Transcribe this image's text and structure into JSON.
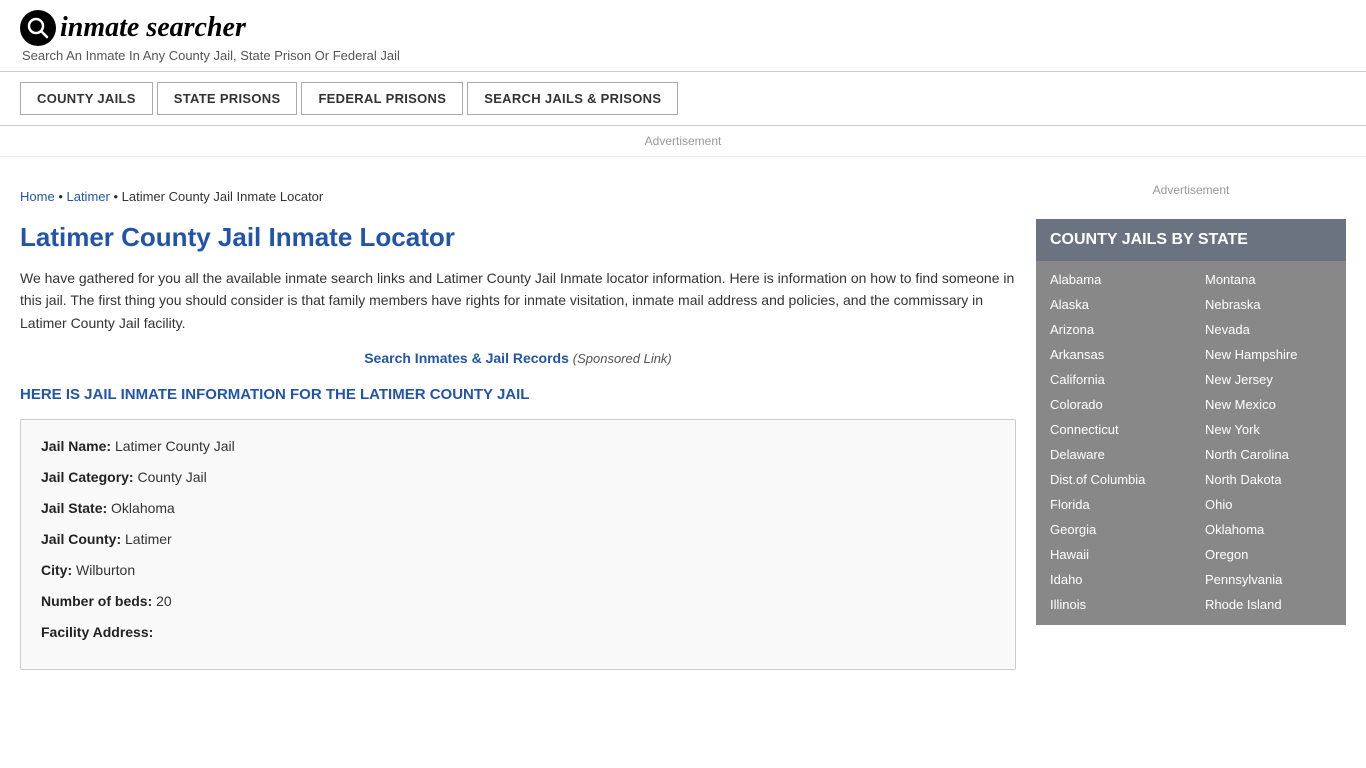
{
  "logo": {
    "icon_text": "Q",
    "text": "inmate searcher",
    "tagline": "Search An Inmate In Any County Jail, State Prison Or Federal Jail"
  },
  "nav": {
    "items": [
      {
        "label": "COUNTY JAILS"
      },
      {
        "label": "STATE PRISONS"
      },
      {
        "label": "FEDERAL PRISONS"
      },
      {
        "label": "SEARCH JAILS & PRISONS"
      }
    ]
  },
  "ad_top": "Advertisement",
  "breadcrumb": {
    "home": "Home",
    "parent": "Latimer",
    "current": "Latimer County Jail Inmate Locator"
  },
  "page_title": "Latimer County Jail Inmate Locator",
  "description": "We have gathered for you all the available inmate search links and Latimer County Jail Inmate locator information. Here is information on how to find someone in this jail. The first thing you should consider is that family members have rights for inmate visitation, inmate mail address and policies, and the commissary in Latimer County Jail facility.",
  "search_link": {
    "label": "Search Inmates & Jail Records",
    "sponsored": "(Sponsored Link)"
  },
  "jail_info_header": "HERE IS JAIL INMATE INFORMATION FOR THE LATIMER COUNTY JAIL",
  "jail_info": {
    "name_label": "Jail Name:",
    "name_value": "Latimer County Jail",
    "category_label": "Jail Category:",
    "category_value": "County Jail",
    "state_label": "Jail State:",
    "state_value": "Oklahoma",
    "county_label": "Jail County:",
    "county_value": "Latimer",
    "city_label": "City:",
    "city_value": "Wilburton",
    "beds_label": "Number of beds:",
    "beds_value": "20",
    "address_label": "Facility Address:"
  },
  "sidebar": {
    "ad": "Advertisement",
    "box_title": "COUNTY JAILS BY STATE",
    "states_left": [
      "Alabama",
      "Alaska",
      "Arizona",
      "Arkansas",
      "California",
      "Colorado",
      "Connecticut",
      "Delaware",
      "Dist.of Columbia",
      "Florida",
      "Georgia",
      "Hawaii",
      "Idaho",
      "Illinois"
    ],
    "states_right": [
      "Montana",
      "Nebraska",
      "Nevada",
      "New Hampshire",
      "New Jersey",
      "New Mexico",
      "New York",
      "North Carolina",
      "North Dakota",
      "Ohio",
      "Oklahoma",
      "Oregon",
      "Pennsylvania",
      "Rhode Island"
    ]
  }
}
